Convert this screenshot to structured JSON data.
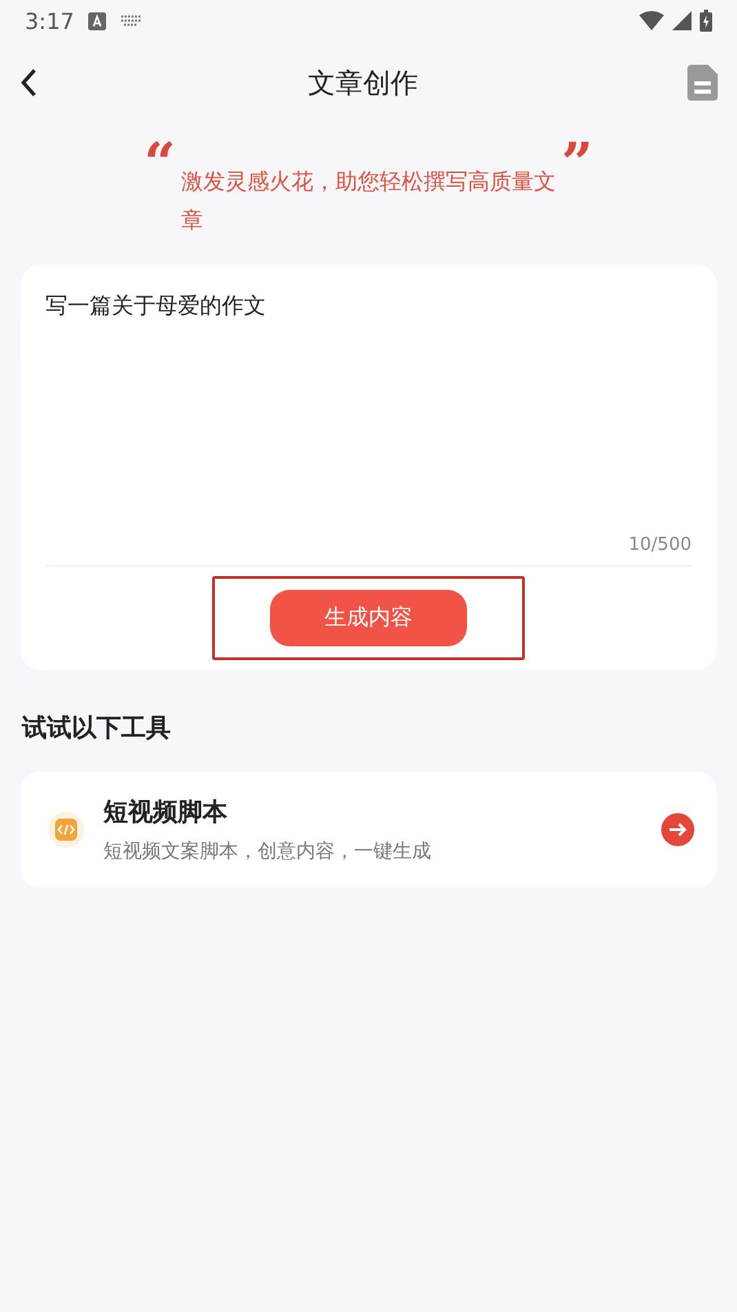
{
  "status_bar": {
    "time": "3:17"
  },
  "header": {
    "title": "文章创作"
  },
  "slogan": {
    "open_quote": "“",
    "text": "激发灵感火花，助您轻松撰写高质量文章",
    "close_quote": "”"
  },
  "prompt": {
    "value": "写一篇关于母爱的作文",
    "counter": "10/500"
  },
  "generate_button": {
    "label": "生成内容",
    "highlighted": true
  },
  "tools_section": {
    "title": "试试以下工具",
    "items": [
      {
        "title": "短视频脚本",
        "description": "短视频文案脚本，创意内容，一键生成"
      }
    ]
  }
}
